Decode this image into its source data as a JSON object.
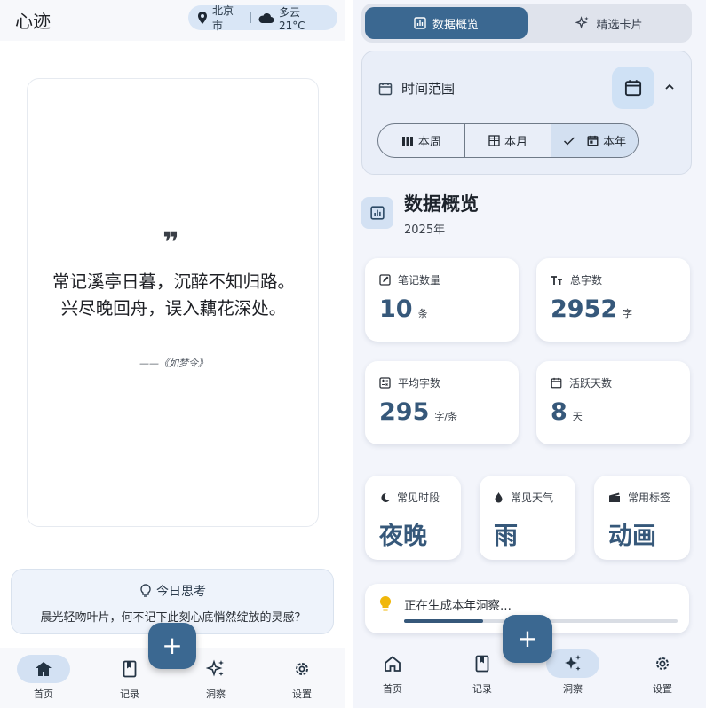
{
  "colors": {
    "accent": "#3b6891",
    "accent_light": "#d3e1f3",
    "value_text": "#36587a"
  },
  "left": {
    "header": {
      "title": "心迹",
      "location": "北京市",
      "weather": "多云 21°C"
    },
    "quote": {
      "mark": "❞",
      "text": "常记溪亭日暮，沉醉不知归路。兴尽晚回舟，误入藕花深处。",
      "source": "——《如梦令》"
    },
    "today_thinking": {
      "title": "今日思考",
      "text": "晨光轻吻叶片，何不记下此刻心底悄然绽放的灵感？"
    },
    "fab_label": "+",
    "nav": [
      {
        "label": "首页",
        "icon": "home-icon",
        "active": true
      },
      {
        "label": "记录",
        "icon": "book-icon",
        "active": false
      },
      {
        "label": "洞察",
        "icon": "sparkle-icon",
        "active": false
      },
      {
        "label": "设置",
        "icon": "gear-icon",
        "active": false
      }
    ]
  },
  "right": {
    "tabs": [
      {
        "label": "数据概览",
        "icon": "bar-chart-icon",
        "active": true
      },
      {
        "label": "精选卡片",
        "icon": "sparkle-icon",
        "active": false
      }
    ],
    "time_range": {
      "title": "时间范围",
      "options": [
        {
          "label": "本周",
          "icon": "week-icon"
        },
        {
          "label": "本月",
          "icon": "grid-icon"
        },
        {
          "label": "本年",
          "icon": "calendar-icon",
          "selected": true
        }
      ]
    },
    "overview": {
      "title": "数据概览",
      "subtitle": "2025年"
    },
    "stats": [
      {
        "label": "笔记数量",
        "value": "10",
        "unit": "条",
        "icon": "note-icon"
      },
      {
        "label": "总字数",
        "value": "2952",
        "unit": "字",
        "icon": "text-size-icon"
      },
      {
        "label": "平均字数",
        "value": "295",
        "unit": "字/条",
        "icon": "calculator-icon"
      },
      {
        "label": "活跃天数",
        "value": "8",
        "unit": "天",
        "icon": "calendar-icon"
      }
    ],
    "small_stats": [
      {
        "label": "常见时段",
        "value": "夜晚",
        "icon": "moon-icon"
      },
      {
        "label": "常见天气",
        "value": "雨",
        "icon": "drop-icon"
      },
      {
        "label": "常用标签",
        "value": "动画",
        "icon": "clapper-icon"
      }
    ],
    "insight": {
      "text": "正在生成本年洞察...",
      "progress": 0.29
    },
    "fab_label": "+",
    "nav": [
      {
        "label": "首页",
        "icon": "home-icon",
        "active": false
      },
      {
        "label": "记录",
        "icon": "book-icon",
        "active": false
      },
      {
        "label": "洞察",
        "icon": "sparkle-icon",
        "active": true
      },
      {
        "label": "设置",
        "icon": "gear-icon",
        "active": false
      }
    ]
  }
}
